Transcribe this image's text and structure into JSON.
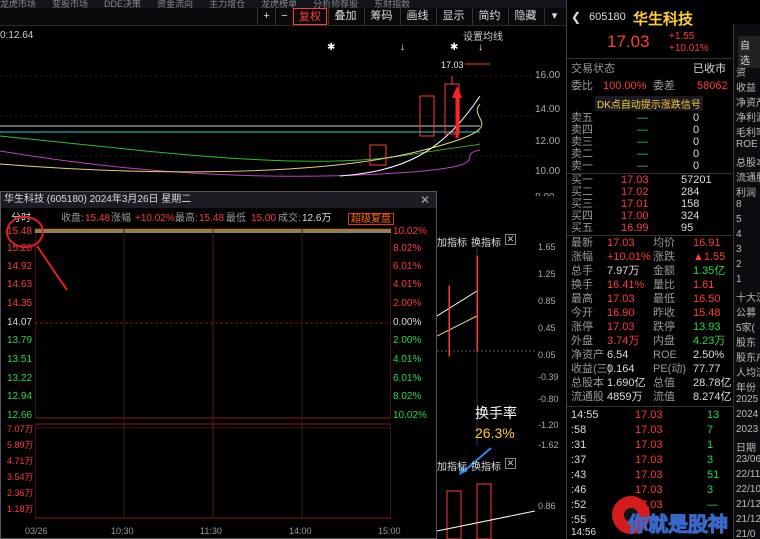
{
  "top_tabs": [
    "龙虎市场",
    "变股市场",
    "DDE决策",
    "资金流向",
    "主力增仓",
    "龙虎榜单",
    "分析师荐股",
    "东财指数",
    "陆股通",
    "热门概念",
    "龙虎榜单"
  ],
  "toolbar": {
    "buttons": [
      "+",
      "−",
      "复权",
      "叠加",
      "筹码",
      "画线",
      "显示",
      "简约",
      "隐藏"
    ],
    "settings": "设置均线"
  },
  "kchart": {
    "price_label": "0:12.64",
    "high_tag": "17.03",
    "axis": [
      "16.00",
      "14.00",
      "12.00",
      "10.00",
      "8.00"
    ]
  },
  "popup": {
    "title": "华生科技 (605180)  2024年3月26日 星期二",
    "tab": "分时",
    "close_label": "收盘:",
    "close": "15.48",
    "change_label": "涨幅",
    "change": "+10.02%",
    "high_label": "最高:",
    "high": "15.48",
    "low_label": "最低",
    "low": "15.00",
    "vol_label": "成交:",
    "vol": "12.6万",
    "super_btn": "超级复盘",
    "left_axis": [
      "15.48",
      "15.20",
      "14.92",
      "14.63",
      "14.35",
      "14.07",
      "13.79",
      "13.51",
      "13.22",
      "12.94",
      "12.66"
    ],
    "right_axis": [
      "10.02%",
      "8.02%",
      "6.01%",
      "4.01%",
      "2.00%",
      "0.00%",
      "2.00%",
      "4.01%",
      "6.01%",
      "8.02%",
      "10.02%"
    ],
    "vol_axis": [
      "7.07万",
      "5.89万",
      "4.71万",
      "3.54万",
      "2.36万",
      "1.18万"
    ],
    "time_axis": [
      "03/26",
      "10:30",
      "11:30",
      "14:00",
      "15:00"
    ]
  },
  "mid": {
    "add_label": "加指标",
    "swap_label": "换指标",
    "axis1": [
      "1.65",
      "1.25",
      "0.85",
      "0.45",
      "0.05",
      "-0.39",
      "-0.80",
      "-1.20",
      "-1.62"
    ],
    "axis2": [
      "0.86"
    ],
    "annotation_title": "换手率",
    "annotation_value": "26.3%"
  },
  "quote": {
    "code": "605180",
    "name": "华生科技",
    "price": "17.03",
    "chg": "+1.55",
    "pct": "+10.01%",
    "status_label": "交易状态",
    "status": "已收市",
    "ratio_label": "委比",
    "ratio": "100.00%",
    "diff_label": "委差",
    "diff": "58062",
    "signal": "DK点自动提示涨跌信号",
    "asks": [
      {
        "l": "卖五",
        "p": "—",
        "v": "0"
      },
      {
        "l": "卖四",
        "p": "—",
        "v": "0"
      },
      {
        "l": "卖三",
        "p": "—",
        "v": "0"
      },
      {
        "l": "卖二",
        "p": "—",
        "v": "0"
      },
      {
        "l": "卖一",
        "p": "—",
        "v": "0"
      }
    ],
    "bids": [
      {
        "l": "买一",
        "p": "17.03",
        "v": "57201"
      },
      {
        "l": "买二",
        "p": "17.02",
        "v": "284"
      },
      {
        "l": "买三",
        "p": "17.01",
        "v": "158"
      },
      {
        "l": "买四",
        "p": "17.00",
        "v": "324"
      },
      {
        "l": "买五",
        "p": "16.99",
        "v": "95"
      }
    ],
    "stats": [
      [
        "最新",
        "17.03",
        "均价",
        "16.91"
      ],
      [
        "涨幅",
        "+10.01%",
        "涨跌",
        "▲1.55"
      ],
      [
        "总手",
        "7.97万",
        "金额",
        "1.35亿"
      ],
      [
        "换手",
        "16.41%",
        "量比",
        "1.61"
      ],
      [
        "最高",
        "17.03",
        "最低",
        "16.50"
      ],
      [
        "今开",
        "16.90",
        "昨收",
        "15.48"
      ],
      [
        "涨停",
        "17.03",
        "跌停",
        "13.93"
      ],
      [
        "外盘",
        "3.74万",
        "内盘",
        "4.23万"
      ],
      [
        "净资产",
        "6.54",
        "ROE",
        "2.50%"
      ],
      [
        "收益(三)",
        "0.164",
        "PE(动)",
        "77.77"
      ],
      [
        "总股本",
        "1.690亿",
        "总值",
        "28.78亿"
      ],
      [
        "流通股",
        "4859万",
        "流值",
        "8.274亿"
      ]
    ],
    "ticks": [
      [
        "14:55",
        "17.03",
        "13"
      ],
      [
        ":58",
        "17.03",
        "7"
      ],
      [
        ":31",
        "17.03",
        "1"
      ],
      [
        ":37",
        "17.03",
        "3"
      ],
      [
        ":43",
        "17.03",
        "51"
      ],
      [
        ":46",
        "17.03",
        "3"
      ],
      [
        ":52",
        "17.03",
        "—"
      ],
      [
        ":55",
        "—",
        "—"
      ]
    ],
    "tick_last": "14:56"
  },
  "strip": [
    "自选",
    "资",
    "收益",
    "净资产",
    "净利润",
    "毛利率",
    "ROE",
    "总股本",
    "流通股",
    "利润",
    "8",
    "5",
    "4",
    "3",
    "2",
    "1",
    "十大流",
    "公募",
    "5家(",
    "股东",
    "股东户",
    "人均流",
    "年份",
    "2025",
    "2024",
    "2023",
    "日期",
    "23/06",
    "22/11",
    "22/10",
    "21/12",
    "21/12",
    "21/0"
  ],
  "watermark": "你就是股神",
  "colors": {
    "red": "#ff3b3b",
    "green": "#2ad84a",
    "yellow": "#ffcc33"
  }
}
